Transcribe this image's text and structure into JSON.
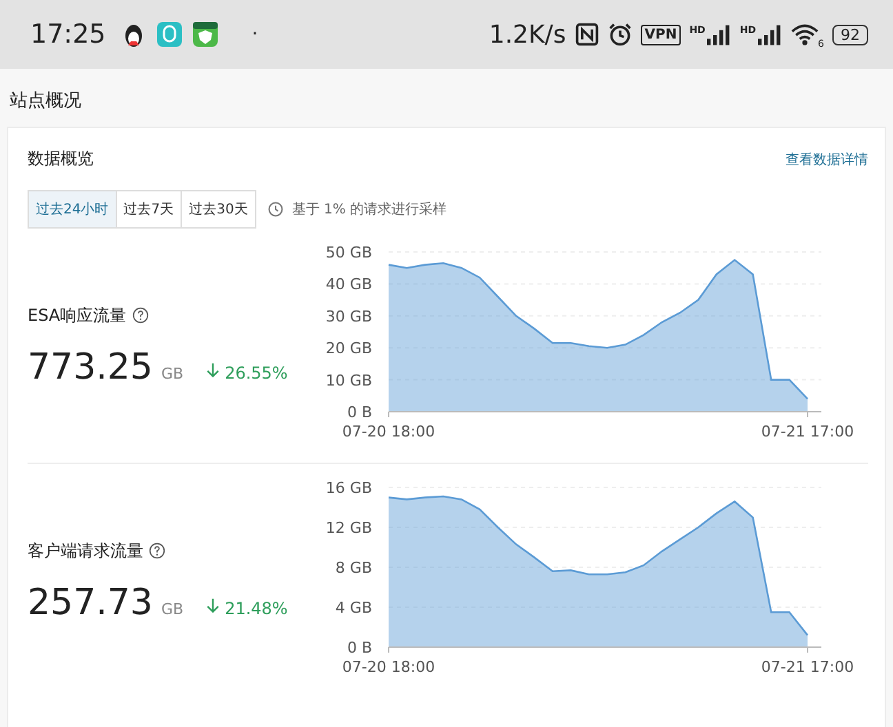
{
  "status_bar": {
    "time": "17:25",
    "dot": "·",
    "speed": "1.2K/s",
    "vpn": "VPN",
    "signals": [
      "HD",
      "HD"
    ],
    "wifi_badge": "6",
    "battery": "92"
  },
  "page_title": "站点概况",
  "card": {
    "title": "数据概览",
    "link": "查看数据详情",
    "ranges": [
      {
        "label": "过去24小时",
        "selected": true
      },
      {
        "label": "过去7天",
        "selected": false
      },
      {
        "label": "过去30天",
        "selected": false
      }
    ],
    "sampling_note": "基于 1% 的请求进行采样",
    "metrics": [
      {
        "name": "ESA响应流量",
        "value": "773.25",
        "unit": "GB",
        "change": "26.55%",
        "chart_data": {
          "type": "area",
          "categories": [
            "07-20 18:00",
            null,
            null,
            null,
            null,
            null,
            null,
            null,
            null,
            null,
            null,
            null,
            null,
            null,
            null,
            null,
            null,
            null,
            null,
            null,
            null,
            null,
            null,
            "07-21 17:00"
          ],
          "grid": true,
          "ylim": [
            0,
            50
          ],
          "yticks": [
            {
              "value": 0,
              "label": "0 B"
            },
            {
              "value": 10,
              "label": "10 GB"
            },
            {
              "value": 20,
              "label": "20 GB"
            },
            {
              "value": 30,
              "label": "30 GB"
            },
            {
              "value": 40,
              "label": "40 GB"
            },
            {
              "value": 50,
              "label": "50 GB"
            }
          ],
          "series": [
            {
              "color": "#5b9bd5",
              "values": [
                46,
                45,
                46,
                46.5,
                45,
                42,
                36,
                30,
                26,
                21.5,
                21.5,
                20.5,
                20,
                21,
                24,
                28,
                31,
                35,
                43,
                47.5,
                43,
                10,
                10,
                4
              ]
            }
          ]
        }
      },
      {
        "name": "客户端请求流量",
        "value": "257.73",
        "unit": "GB",
        "change": "21.48%",
        "chart_data": {
          "type": "area",
          "categories": [
            "07-20 18:00",
            null,
            null,
            null,
            null,
            null,
            null,
            null,
            null,
            null,
            null,
            null,
            null,
            null,
            null,
            null,
            null,
            null,
            null,
            null,
            null,
            null,
            null,
            "07-21 17:00"
          ],
          "grid": true,
          "ylim": [
            0,
            16
          ],
          "yticks": [
            {
              "value": 0,
              "label": "0 B"
            },
            {
              "value": 4,
              "label": "4 GB"
            },
            {
              "value": 8,
              "label": "8 GB"
            },
            {
              "value": 12,
              "label": "12 GB"
            },
            {
              "value": 16,
              "label": "16 GB"
            }
          ],
          "series": [
            {
              "color": "#5b9bd5",
              "values": [
                15,
                14.8,
                15,
                15.1,
                14.8,
                13.8,
                12,
                10.3,
                9,
                7.6,
                7.7,
                7.3,
                7.3,
                7.5,
                8.2,
                9.6,
                10.8,
                12,
                13.4,
                14.6,
                13,
                3.5,
                3.5,
                1.2
              ]
            }
          ]
        }
      }
    ]
  }
}
